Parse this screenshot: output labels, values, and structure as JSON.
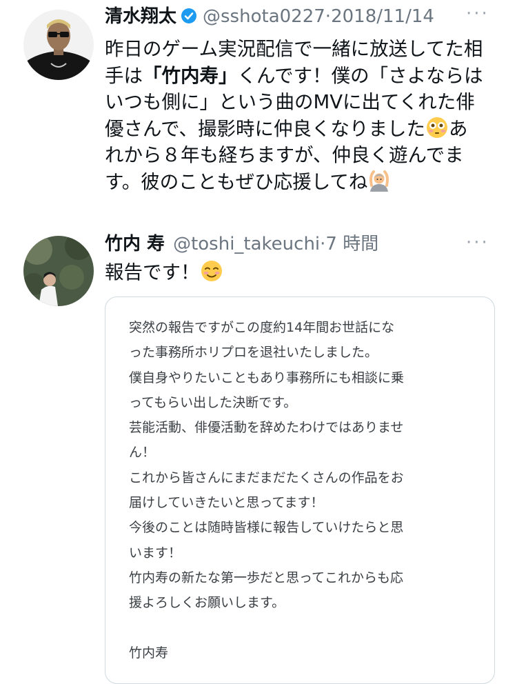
{
  "tweet1": {
    "name": "清水翔太",
    "handle": "@sshota0227",
    "separator": "·",
    "time": "2018/11/14",
    "lines": [
      "昨日のゲーム実況配信で一緒に放送してた相",
      "手は",
      "「竹内寿」",
      "くんです！僕の「さよならは",
      "いつも側に」という曲のMVに出てくれた俳",
      "優さんで、撮影時に仲良くなりました",
      "あ",
      "れから８年も経ちますが、仲良く遊んでま",
      "す。彼のこともぜひ応援してね"
    ],
    "emoji1": "flushed-face",
    "emoji2": "person-gesturing-ok"
  },
  "tweet2": {
    "name": "竹内 寿",
    "handle": "@toshi_takeuchi",
    "separator": "·",
    "time": "7 時間",
    "text": "報告です！",
    "emoji": "smiling-face",
    "card_lines": [
      "突然の報告ですがこの度約14年間お世話にな",
      "った事務所ホリプロを退社いたしました。",
      "僕自身やりたいこともあり事務所にも相談に乗",
      "ってもらい出した決断です。",
      "芸能活動、俳優活動を辞めたわけではありませ",
      "ん！",
      "これから皆さんにまだまだたくさんの作品をお",
      "届けしていきたいと思ってます！",
      "今後のことは随時皆様に報告していけたらと思",
      "います！",
      "竹内寿の新たな第一歩だと思ってこれからも応",
      "援よろしくお願いします。",
      "",
      "竹内寿"
    ]
  },
  "colors": {
    "text": "#0f1419",
    "secondary": "#6b7580",
    "verified": "#1d9bf0",
    "card_border": "#cfd9de"
  }
}
